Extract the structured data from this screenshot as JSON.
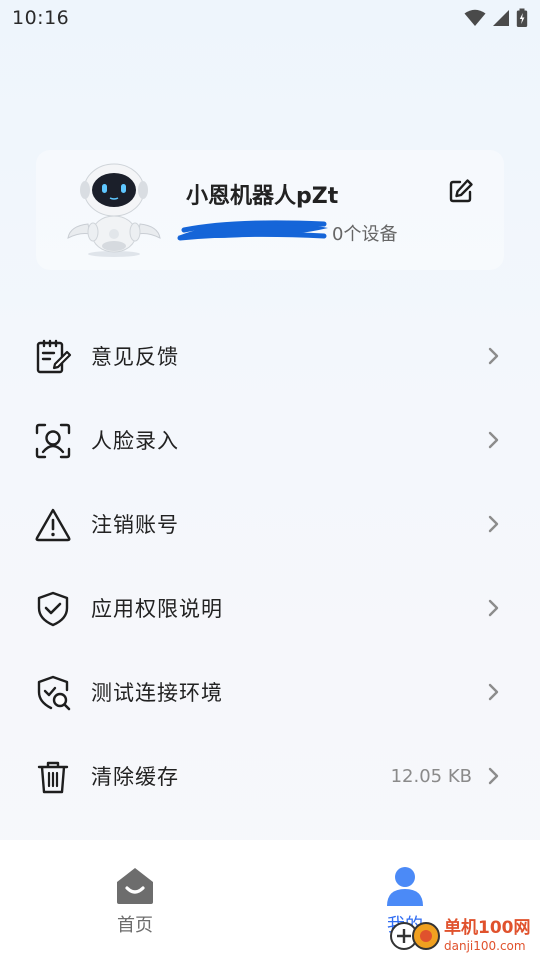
{
  "status_bar": {
    "time": "10:16"
  },
  "profile": {
    "username": "小恩机器人pZt",
    "device_count": "0个设备"
  },
  "menu": {
    "items": [
      {
        "label": "意见反馈",
        "icon": "feedback-icon"
      },
      {
        "label": "人脸录入",
        "icon": "face-scan-icon"
      },
      {
        "label": "注销账号",
        "icon": "warning-icon"
      },
      {
        "label": "应用权限说明",
        "icon": "shield-check-icon"
      },
      {
        "label": "测试连接环境",
        "icon": "shield-search-icon"
      },
      {
        "label": "清除缓存",
        "icon": "trash-icon",
        "value": "12.05 KB"
      }
    ]
  },
  "tab_bar": {
    "tabs": [
      {
        "label": "首页",
        "icon": "home-icon",
        "active": false
      },
      {
        "label": "我的",
        "icon": "person-icon",
        "active": true
      }
    ],
    "active_color": "#2f6cf2",
    "inactive_color": "#6d6d6d"
  },
  "watermark": {
    "title": "单机100网",
    "url": "danji100.com"
  }
}
